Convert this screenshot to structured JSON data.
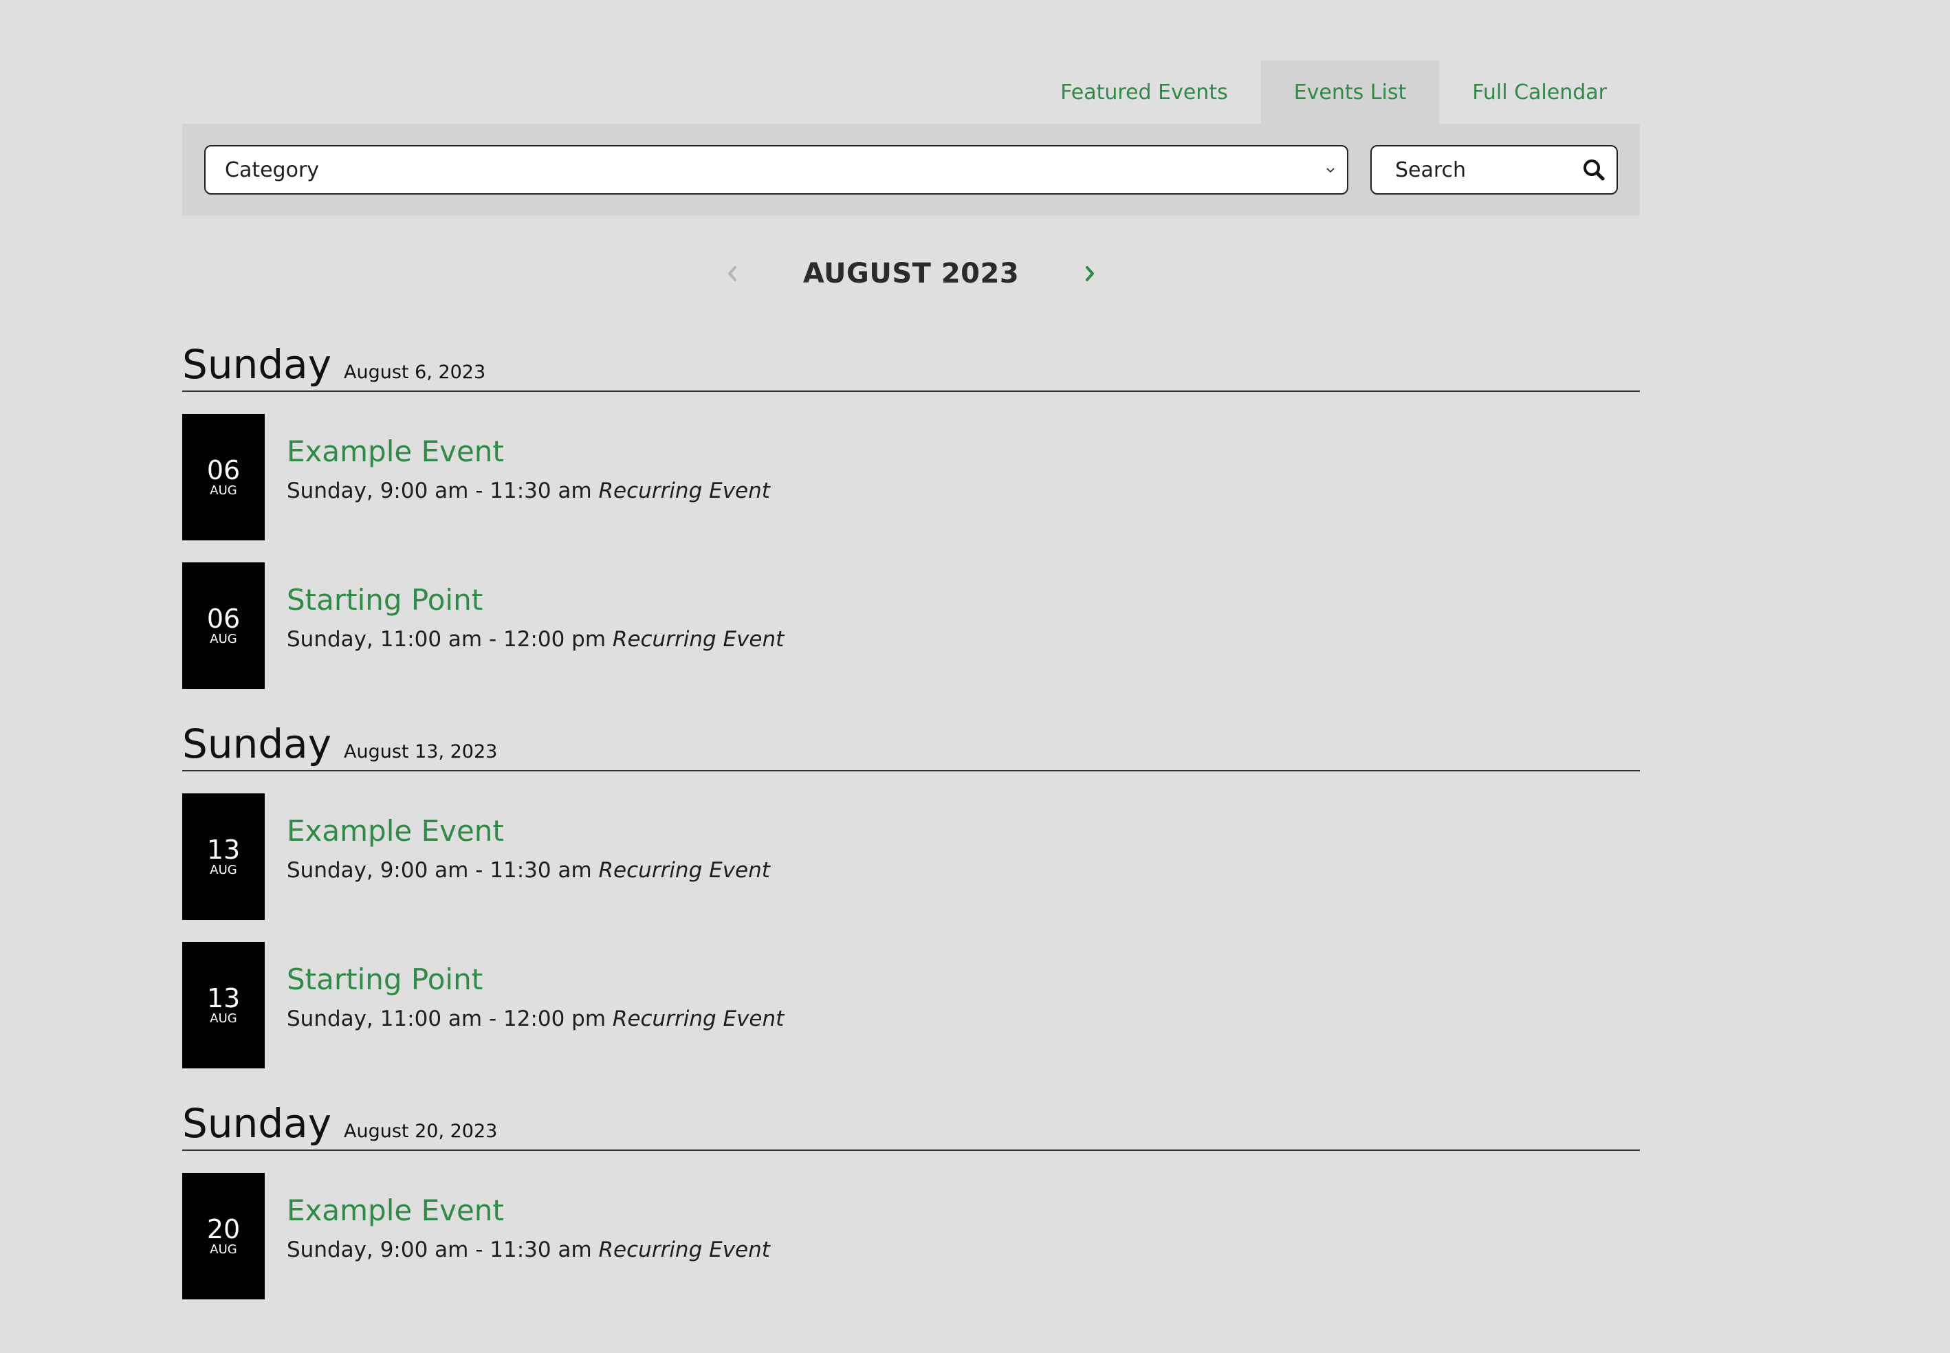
{
  "tabs": [
    {
      "label": "Featured Events",
      "active": false
    },
    {
      "label": "Events List",
      "active": true
    },
    {
      "label": "Full Calendar",
      "active": false
    }
  ],
  "filters": {
    "category_value": "Category",
    "search_placeholder": "Search"
  },
  "month_nav": {
    "title": "AUGUST 2023"
  },
  "colors": {
    "accent": "#2e8b45",
    "background": "#dfdfdf",
    "panel": "#d3d3d3",
    "date_box": "#000000"
  },
  "days": [
    {
      "name": "Sunday",
      "date": "August 6, 2023",
      "events": [
        {
          "day_num": "06",
          "month": "AUG",
          "title": "Example Event",
          "time": "Sunday, 9:00 am - 11:30 am",
          "recurring": "Recurring Event"
        },
        {
          "day_num": "06",
          "month": "AUG",
          "title": "Starting Point",
          "time": "Sunday, 11:00 am - 12:00 pm",
          "recurring": "Recurring Event"
        }
      ]
    },
    {
      "name": "Sunday",
      "date": "August 13, 2023",
      "events": [
        {
          "day_num": "13",
          "month": "AUG",
          "title": "Example Event",
          "time": "Sunday, 9:00 am - 11:30 am",
          "recurring": "Recurring Event"
        },
        {
          "day_num": "13",
          "month": "AUG",
          "title": "Starting Point",
          "time": "Sunday, 11:00 am - 12:00 pm",
          "recurring": "Recurring Event"
        }
      ]
    },
    {
      "name": "Sunday",
      "date": "August 20, 2023",
      "events": [
        {
          "day_num": "20",
          "month": "AUG",
          "title": "Example Event",
          "time": "Sunday, 9:00 am - 11:30 am",
          "recurring": "Recurring Event"
        }
      ]
    }
  ]
}
